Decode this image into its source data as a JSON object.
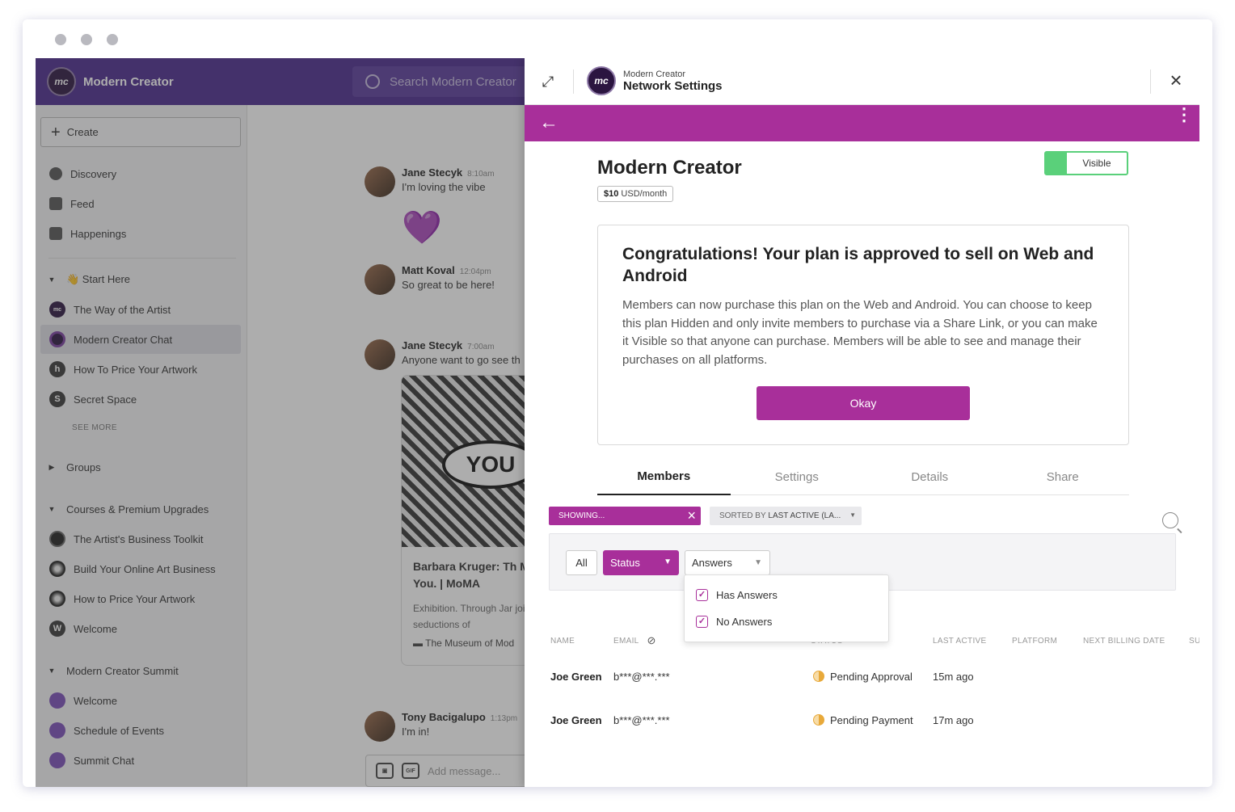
{
  "app": {
    "name": "Modern Creator",
    "logo_text": "mc",
    "search_placeholder": "Search Modern Creator"
  },
  "sidebar": {
    "create_label": "Create",
    "main_items": [
      {
        "label": "Discovery",
        "icon": "compass-icon"
      },
      {
        "label": "Feed",
        "icon": "feed-icon"
      },
      {
        "label": "Happenings",
        "icon": "calendar-icon"
      }
    ],
    "start_here": {
      "title": "👋 Start Here",
      "items": [
        {
          "label": "The Way of the Artist",
          "avatar": "mc"
        },
        {
          "label": "Modern Creator Chat",
          "avatar": ""
        },
        {
          "label": "How To Price Your Artwork",
          "avatar": "h"
        },
        {
          "label": "Secret Space",
          "avatar": "S"
        }
      ],
      "see_more": "SEE MORE"
    },
    "groups_title": "Groups",
    "courses": {
      "title": "Courses & Premium Upgrades",
      "items": [
        {
          "label": "The Artist's Business Toolkit"
        },
        {
          "label": "Build Your Online Art Business"
        },
        {
          "label": "How to Price Your Artwork"
        },
        {
          "label": "Welcome",
          "avatar": "W"
        }
      ]
    },
    "summit": {
      "title": "Modern Creator Summit",
      "items": [
        {
          "label": "Welcome"
        },
        {
          "label": "Schedule of Events"
        },
        {
          "label": "Summit Chat"
        }
      ]
    }
  },
  "chat": {
    "messages": [
      {
        "author": "Jane Stecyk",
        "time": "8:10am",
        "text": "I'm loving the vibe"
      },
      {
        "author": "Matt Koval",
        "time": "12:04pm",
        "text": "So great to be here!"
      },
      {
        "author": "Jane Stecyk",
        "time": "7:00am",
        "text": "Anyone want to go see th"
      },
      {
        "author": "Tony Bacigalupo",
        "time": "1:13pm",
        "text": "I'm in!"
      }
    ],
    "heart": "💜",
    "link_card": {
      "image_text": "YOU",
      "title": "Barbara Kruger: Th Mean You. | MoMA",
      "description": "Exhibition. Through Jar joins the seductions of",
      "source": "The Museum of Mod"
    },
    "compose_placeholder": "Add message..."
  },
  "panel": {
    "header_small": "Modern Creator",
    "header_big": "Network Settings",
    "plan_name": "Modern Creator",
    "price_amount": "$10",
    "price_unit": "USD/month",
    "visibility_label": "Visible",
    "congrats_title": "Congratulations! Your plan is approved to sell on Web and Android",
    "congrats_body": "Members can now purchase this plan on the Web and Android. You can choose to keep this plan Hidden and only invite members to purchase via a Share Link, or you can make it Visible so that anyone can purchase. Members will be able to see and manage their purchases on all platforms.",
    "okay_label": "Okay",
    "tabs": [
      "Members",
      "Settings",
      "Details",
      "Share"
    ],
    "showing_label": "SHOWING...",
    "sorted_prefix": "SORTED BY",
    "sorted_value": "LAST ACTIVE (LA...",
    "filters": {
      "all": "All",
      "status": "Status",
      "answers": "Answers"
    },
    "answers_options": [
      {
        "label": "Has Answers",
        "checked": true
      },
      {
        "label": "No Answers",
        "checked": true
      }
    ],
    "columns": [
      "NAME",
      "EMAIL",
      "STATUS",
      "LAST ACTIVE",
      "PLATFORM",
      "NEXT BILLING DATE",
      "SU"
    ],
    "rows": [
      {
        "name": "Joe Green",
        "email": "b***@***.***",
        "status": "Pending Approval",
        "last_active": "15m ago"
      },
      {
        "name": "Joe Green",
        "email": "b***@***.***",
        "status": "Pending Payment",
        "last_active": "17m ago"
      }
    ]
  },
  "colors": {
    "topbar": "#4a2a8e",
    "accent": "#a82f9a",
    "visible_green": "#5ad07a",
    "status_pending": "#e8a93a"
  }
}
